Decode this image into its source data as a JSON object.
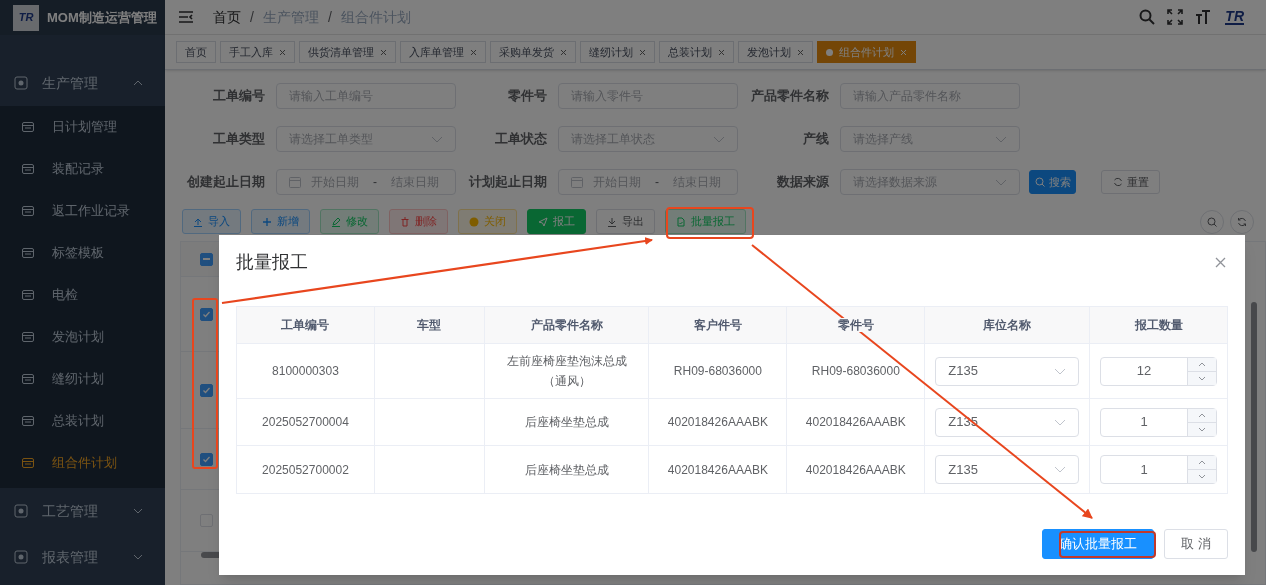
{
  "app": {
    "title": "MOM制造运营管理",
    "logo_text": "TR"
  },
  "sidebar": {
    "items": [
      {
        "label": "生产管理",
        "expanded": true,
        "children": [
          {
            "label": "日计划管理",
            "selected": false
          },
          {
            "label": "装配记录",
            "selected": false
          },
          {
            "label": "返工作业记录",
            "selected": false
          },
          {
            "label": "标签模板",
            "selected": false
          },
          {
            "label": "电检",
            "selected": false
          },
          {
            "label": "发泡计划",
            "selected": false
          },
          {
            "label": "缝纫计划",
            "selected": false
          },
          {
            "label": "总装计划",
            "selected": false
          },
          {
            "label": "组合件计划",
            "selected": true
          }
        ]
      },
      {
        "label": "工艺管理",
        "expanded": false
      },
      {
        "label": "报表管理",
        "expanded": false
      }
    ]
  },
  "breadcrumb": {
    "separator": "/",
    "items": [
      "首页",
      "生产管理",
      "组合件计划"
    ]
  },
  "header": {
    "logo_text": "TR"
  },
  "tabs": [
    {
      "label": "首页",
      "closable": false,
      "selected": false
    },
    {
      "label": "手工入库",
      "closable": true,
      "selected": false
    },
    {
      "label": "供货清单管理",
      "closable": true,
      "selected": false
    },
    {
      "label": "入库单管理",
      "closable": true,
      "selected": false
    },
    {
      "label": "采购单发货",
      "closable": true,
      "selected": false
    },
    {
      "label": "缝纫计划",
      "closable": true,
      "selected": false
    },
    {
      "label": "总装计划",
      "closable": true,
      "selected": false
    },
    {
      "label": "发泡计划",
      "closable": true,
      "selected": false
    },
    {
      "label": "组合件计划",
      "closable": true,
      "selected": true
    }
  ],
  "filters": [
    {
      "label": "工单编号",
      "kind": "text",
      "placeholder": "请输入工单编号"
    },
    {
      "label": "零件号",
      "kind": "text",
      "placeholder": "请输入零件号"
    },
    {
      "label": "产品零件名称",
      "kind": "text",
      "placeholder": "请输入产品零件名称"
    },
    {
      "label": "工单类型",
      "kind": "select",
      "placeholder": "请选择工单类型"
    },
    {
      "label": "工单状态",
      "kind": "select",
      "placeholder": "请选择工单状态"
    },
    {
      "label": "产线",
      "kind": "select",
      "placeholder": "请选择产线"
    },
    {
      "label": "创建起止日期",
      "kind": "daterange",
      "placeholder": "开始日期",
      "end_placeholder": "结束日期",
      "separator": "-"
    },
    {
      "label": "计划起止日期",
      "kind": "daterange",
      "placeholder": "开始日期",
      "end_placeholder": "结束日期",
      "separator": "-"
    },
    {
      "label": "数据来源",
      "kind": "select",
      "placeholder": "请选择数据来源"
    }
  ],
  "filter_buttons": [
    {
      "label": "搜索",
      "kind": "primary"
    },
    {
      "label": "重置",
      "kind": "default"
    }
  ],
  "toolbar": [
    {
      "label": "导入",
      "kind": "info"
    },
    {
      "label": "新增",
      "kind": "info"
    },
    {
      "label": "修改",
      "kind": "success"
    },
    {
      "label": "删除",
      "kind": "danger"
    },
    {
      "label": "关闭",
      "kind": "warning"
    },
    {
      "label": "报工",
      "kind": "success-solid"
    },
    {
      "label": "导出",
      "kind": "default"
    },
    {
      "label": "批量报工",
      "kind": "success"
    }
  ],
  "list_table": {
    "header_indeterminate": true,
    "rows": [
      {
        "checked": true
      },
      {
        "checked": true
      },
      {
        "checked": true
      },
      {
        "checked": false
      }
    ]
  },
  "dialog": {
    "title": "批量报工",
    "columns": [
      "工单编号",
      "车型",
      "产品零件名称",
      "客户件号",
      "零件号",
      "库位名称",
      "报工数量"
    ],
    "rows": [
      {
        "work_order": "8100000303",
        "product_name": "左前座椅座垫泡沫总成（通风）",
        "customer_part": "RH09-68036000",
        "part_no": "RH09-68036000",
        "location": "Z135",
        "quantity": "12"
      },
      {
        "work_order": "2025052700004",
        "product_name": "后座椅坐垫总成",
        "customer_part": "402018426AAABK",
        "part_no": "402018426AAABK",
        "location": "Z135",
        "quantity": "1"
      },
      {
        "work_order": "2025052700002",
        "product_name": "后座椅坐垫总成",
        "customer_part": "402018426AAABK",
        "part_no": "402018426AAABK",
        "location": "Z135",
        "quantity": "1"
      }
    ],
    "buttons": [
      {
        "label": "确认批量报工",
        "kind": "primary"
      },
      {
        "label": "取 消",
        "kind": "default"
      }
    ]
  }
}
